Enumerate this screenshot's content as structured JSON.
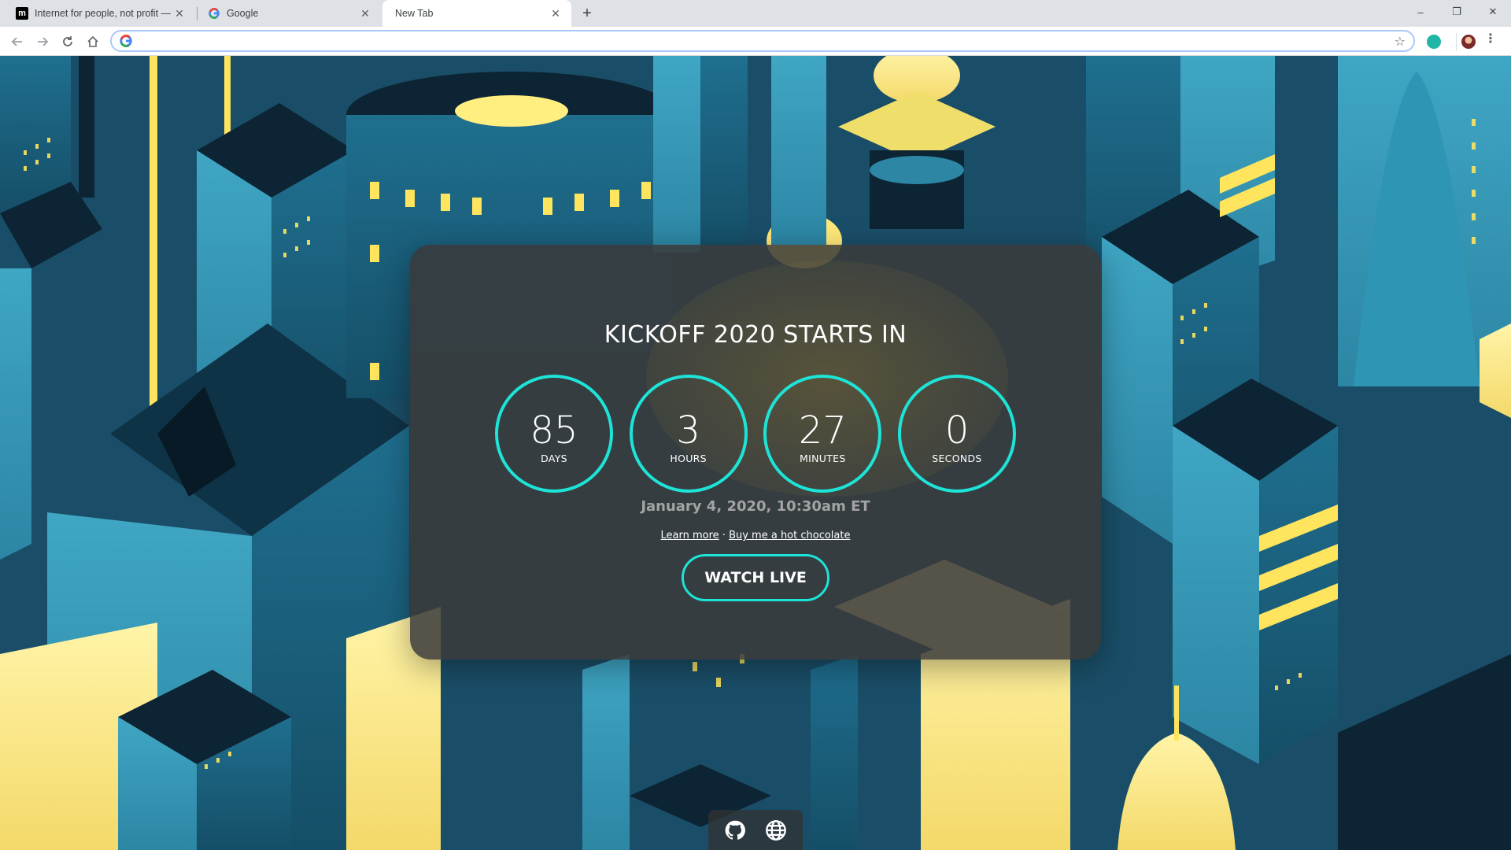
{
  "browser": {
    "tabs": [
      {
        "title": "Internet for people, not profit —",
        "favicon": "m-logo-icon"
      },
      {
        "title": "Google",
        "favicon": "google-g-icon"
      },
      {
        "title": "New Tab",
        "favicon": ""
      }
    ],
    "new_tab_symbol": "+",
    "address": {
      "value": "",
      "placeholder": ""
    },
    "window_controls": {
      "minimize": "–",
      "restore": "❐",
      "close": "✕"
    }
  },
  "countdown": {
    "title": "KICKOFF 2020 STARTS IN",
    "units": [
      {
        "value": "85",
        "label": "DAYS"
      },
      {
        "value": "3",
        "label": "HOURS"
      },
      {
        "value": "27",
        "label": "MINUTES"
      },
      {
        "value": "0",
        "label": "SECONDS"
      }
    ],
    "date": "January 4, 2020, 10:30am ET",
    "links": {
      "learn_more": "Learn more",
      "separator": " · ",
      "hot_chocolate": "Buy me a hot chocolate"
    },
    "watch_button": "WATCH LIVE"
  },
  "footer": {
    "icons": [
      "github-icon",
      "globe-icon"
    ]
  },
  "colors": {
    "accent": "#1ee3d7",
    "card_bg": "#3a3a3a",
    "date_text": "#a3a3a3",
    "window_yellow": "#ffe97a"
  }
}
